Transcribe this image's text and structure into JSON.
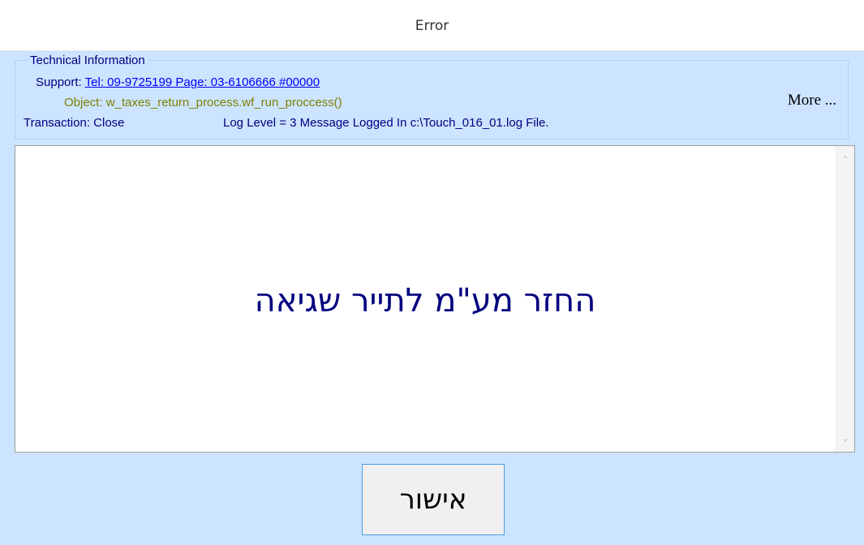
{
  "window": {
    "title": "Error"
  },
  "technical": {
    "legend": "Technical Information",
    "support_label": "Support:",
    "support_value": "Tel: 09-9725199 Page: 03-6106666 #00000",
    "object_label": "Object:",
    "object_value": "w_taxes_return_process.wf_run_proccess()",
    "transaction_label": "Transaction:",
    "transaction_value": "Close",
    "log_text": "Log Level = 3 Message Logged In c:\\Touch_016_01.log File.",
    "more_label": "More ..."
  },
  "message": {
    "text": "החזר  מע\"מ לתייר שגיאה"
  },
  "scrollbar": {
    "up_icon": "chevron-up-icon",
    "down_icon": "chevron-down-icon"
  },
  "buttons": {
    "ok_label": "אישור"
  }
}
